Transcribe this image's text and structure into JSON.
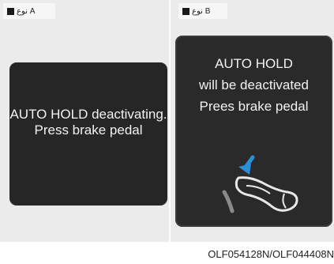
{
  "panel_a": {
    "type_label": "نوع A",
    "message": "AUTO HOLD deactivating. Press brake pedal"
  },
  "panel_b": {
    "type_label": "نوع B",
    "line1": "AUTO HOLD",
    "line2": "will be deactivated",
    "line3": "Prees brake pedal",
    "icon": "brake-pedal-foot-icon"
  },
  "caption": "OLF054128N/OLF044408N",
  "colors": {
    "screen_bg": "#262626",
    "arrow_blue": "#2a8fd6",
    "page_bg": "#ebebeb"
  }
}
